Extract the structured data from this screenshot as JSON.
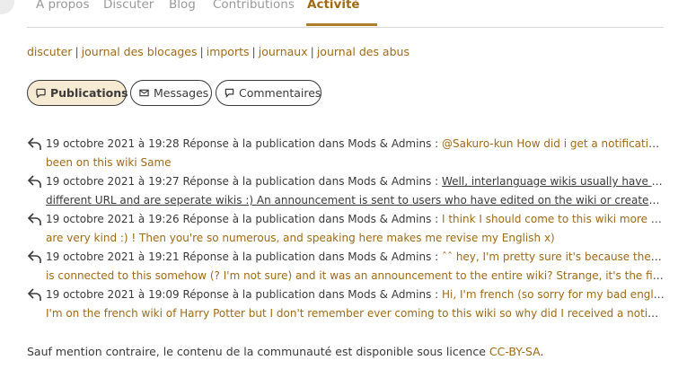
{
  "tabs": [
    {
      "label": "À propos"
    },
    {
      "label": "Discuter"
    },
    {
      "label": "Blog"
    },
    {
      "label": "Contributions"
    },
    {
      "label": "Activité",
      "active": true
    }
  ],
  "subnav": {
    "links": [
      "discuter",
      "journal des blocages",
      "imports",
      "journaux",
      "journal des abus"
    ],
    "separator": "|"
  },
  "filters": {
    "publications": "Publications",
    "messages": "Messages",
    "commentaires": "Commentaires"
  },
  "activity": [
    {
      "date": "19 octobre 2021 à 19:28",
      "action": "Réponse à la publication dans Mods & Admins :",
      "line1": "@Sakuro-kun How did i get a notification i never",
      "line2": "been on this wiki Same"
    },
    {
      "date": "19 octobre 2021 à 19:27",
      "action": "Réponse à la publication dans Mods & Admins :",
      "line1": "Well, interlanguage wikis usually have completely",
      "line2": "different URL and are seperate wikis :) An announcement is sent to users who have edited on the wiki or created, replie…"
    },
    {
      "date": "19 octobre 2021 à 19:26",
      "action": "Réponse à la publication dans Mods & Admins :",
      "line1": "I think I should come to this wiki more often ! You",
      "line2": "are very kind :) ! Then you're so numerous, and speaking here makes me revise my English x)"
    },
    {
      "date": "19 octobre 2021 à 19:21",
      "action": "Réponse à la publication dans Mods & Admins :",
      "line1": "ˆˆ hey, I'm pretty sure it's because the french wiki",
      "line2": "is connected to this somehow (? I'm not sure) and it was an announcement to the entire wiki? Strange, it's the first time…"
    },
    {
      "date": "19 octobre 2021 à 19:09",
      "action": "Réponse à la publication dans Mods & Admins :",
      "line1": "Hi, I'm french (so sorry for my bad english) and",
      "line2": "I'm on the french wiki of Harry Potter but I don't remember ever coming to this wiki so why did I received a notification …"
    }
  ],
  "footer": {
    "text": "Sauf mention contraire, le contenu de la communauté est disponible sous licence",
    "license": "CC-BY-SA",
    "end": "."
  },
  "colors": {
    "accent": "#a06a14",
    "active_pill_bg": "#f6ebd2"
  }
}
